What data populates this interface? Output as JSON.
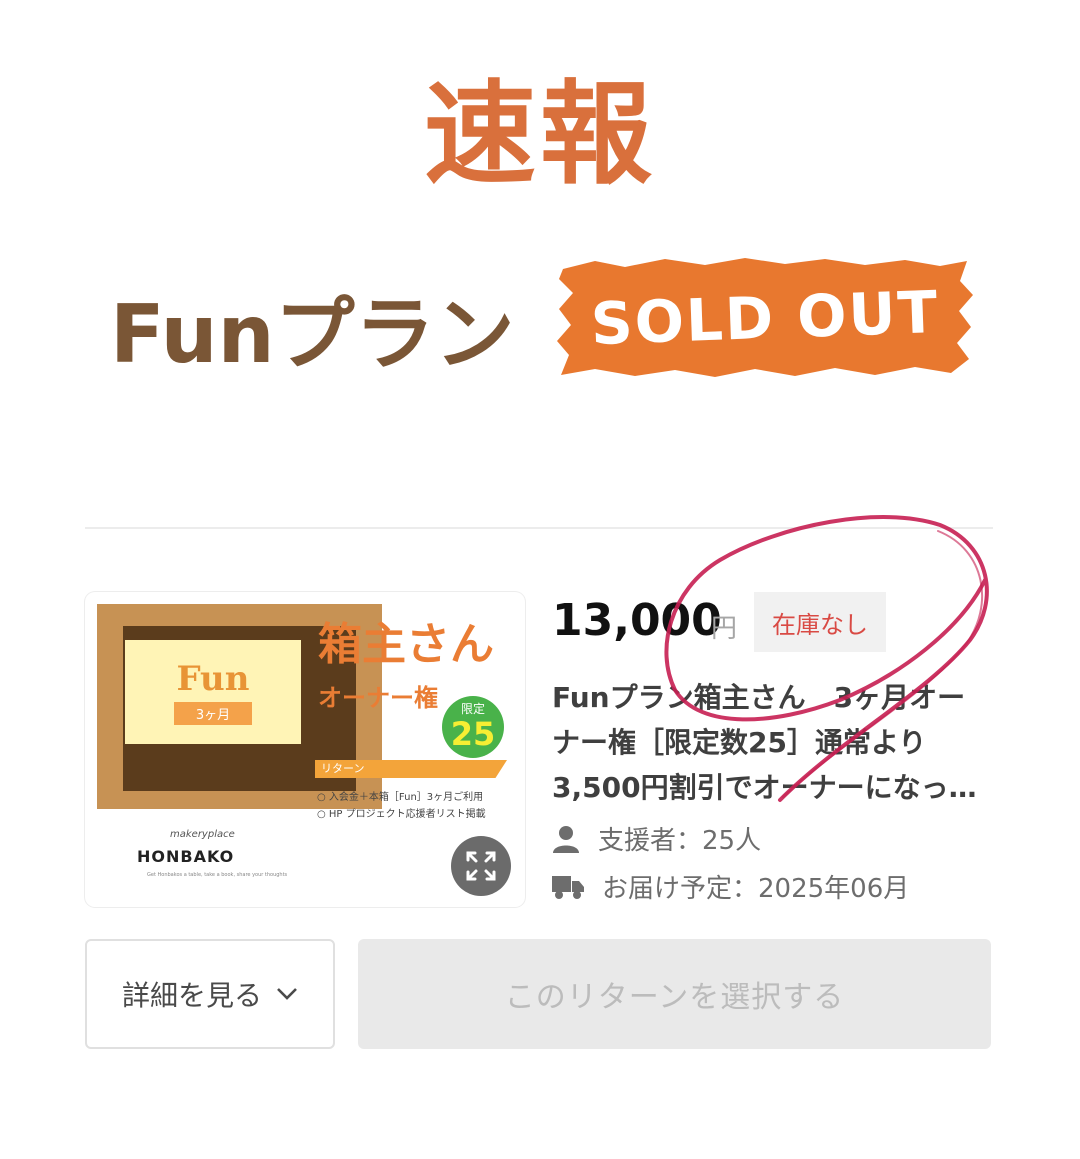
{
  "header": {
    "headline": "速報",
    "plan_title": "Funプラン",
    "sold_out": "SOLD OUT"
  },
  "thumbnail": {
    "fun_word": "Fun",
    "fun_tag": "3ヶ月",
    "name": "箱主さん",
    "owner": "オーナー権",
    "limit_label": "限定",
    "limit_number": "25",
    "return_label": "リターン",
    "items": [
      "○ 入会金＋本箱［Fun］3ヶ月ご利用",
      "○ HP プロジェクト応援者リスト掲載"
    ],
    "brand_script": "makeryplace",
    "brand": "HONBAKO",
    "brand_sub": "Get Honbakos a table, take a book, share your thoughts",
    "expand_icon": "expand-icon"
  },
  "product": {
    "price": "13,000",
    "currency": "円",
    "stock_status": "在庫なし",
    "description": "Funプラン箱主さん　3ヶ月オーナー権［限定数25］通常より3,500円割引でオーナーになっ…",
    "supporters": "支援者：25人",
    "delivery": "お届け予定：2025年06月"
  },
  "actions": {
    "detail_label": "詳細を見る",
    "select_label": "このリターンを選択する"
  },
  "colors": {
    "headline": "#d9703c",
    "plan_title": "#7a5636",
    "sold_out_bg": "#e8782f",
    "stock_text": "#d94a44",
    "scribble": "#c71f52"
  }
}
